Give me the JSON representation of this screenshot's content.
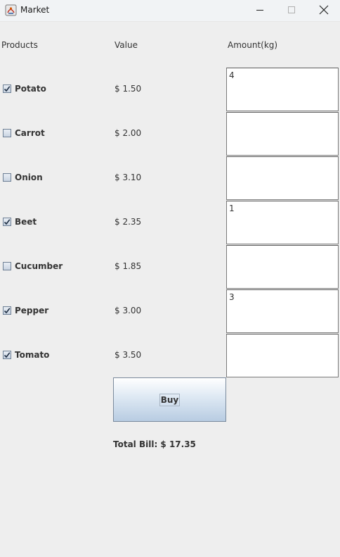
{
  "window": {
    "title": "Market",
    "controls": [
      "minimize-icon",
      "maximize-icon",
      "close-icon"
    ]
  },
  "headers": {
    "products": "Products",
    "value": "Value",
    "amount": "Amount(kg)"
  },
  "products": [
    {
      "name": "Potato",
      "price": "$ 1.50",
      "checked": true,
      "amount": "4"
    },
    {
      "name": "Carrot",
      "price": "$ 2.00",
      "checked": false,
      "amount": ""
    },
    {
      "name": "Onion",
      "price": "$ 3.10",
      "checked": false,
      "amount": ""
    },
    {
      "name": "Beet",
      "price": "$ 2.35",
      "checked": true,
      "amount": "1"
    },
    {
      "name": "Cucumber",
      "price": "$ 1.85",
      "checked": false,
      "amount": ""
    },
    {
      "name": "Pepper",
      "price": "$ 3.00",
      "checked": true,
      "amount": "3"
    },
    {
      "name": "Tomato",
      "price": "$ 3.50",
      "checked": true,
      "amount": ""
    }
  ],
  "buy_button": {
    "label": "Buy"
  },
  "total": {
    "text": "Total Bill: $ 17.35"
  },
  "colors": {
    "background": "#eeeeee",
    "titlebar": "#f1f3f5",
    "button_gradient_top": "#ffffff",
    "button_gradient_bottom": "#b8cce2"
  }
}
